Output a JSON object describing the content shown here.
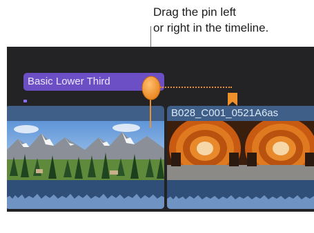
{
  "callout": {
    "line1": "Drag the pin left",
    "line2": "or right in the timeline."
  },
  "timeline": {
    "title_clip": {
      "label": "Basic Lower Third"
    },
    "clip_b": {
      "label": "B028_C001_0521A6as"
    }
  },
  "colors": {
    "timeline_bg": "#232325",
    "title_clip": "#6c4fc4",
    "video_clip": "#3f5f88",
    "audio_wave": "#6f93c2",
    "playhead": "#f0902a"
  },
  "icons": {
    "pin": "playhead-pin-icon",
    "marker": "marker-flag-icon"
  }
}
